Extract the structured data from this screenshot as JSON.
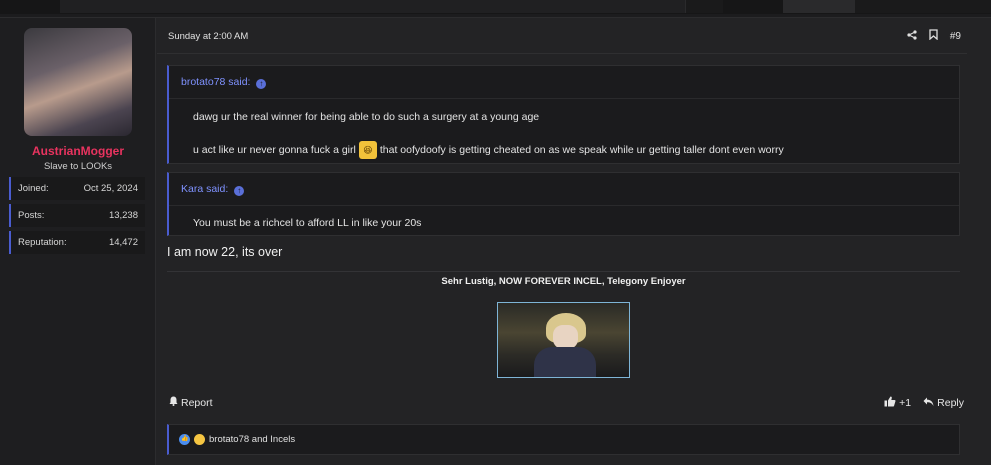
{
  "post": {
    "date": "Sunday at 2:00 AM",
    "number": "#9",
    "icons": {
      "share": "share-icon",
      "bookmark": "bookmark-icon"
    }
  },
  "user": {
    "name": "AustrianMogger",
    "title": "Slave to LOOKs",
    "name_color": "#e8335f",
    "stats": [
      {
        "label": "Joined:",
        "value": "Oct 25, 2024"
      },
      {
        "label": "Posts:",
        "value": "13,238"
      },
      {
        "label": "Reputation:",
        "value": "14,472"
      }
    ]
  },
  "quotes": [
    {
      "author": "brotato78 said:",
      "lines": [
        "dawg ur the real winner for being able to do such a surgery at a young age",
        "u act like ur never gonna fuck a girl",
        "that oofydoofy is getting cheated on as we speak while ur getting taller dont even worry"
      ]
    },
    {
      "author": "Kara said:",
      "lines": [
        "You must be a richcel to afford LL in like your 20s"
      ]
    }
  ],
  "reply_text": "I am now 22, its over",
  "signature": "Sehr Lustig, NOW FOREVER INCEL, Telegony Enjoyer",
  "actions": {
    "report": "Report",
    "like_count": "+1",
    "reply": "Reply"
  },
  "reactions": {
    "text": "brotato78 and Incels"
  },
  "colors": {
    "accent": "#4a5ccf",
    "quote_author": "#7f92ff",
    "background": "#232325"
  }
}
